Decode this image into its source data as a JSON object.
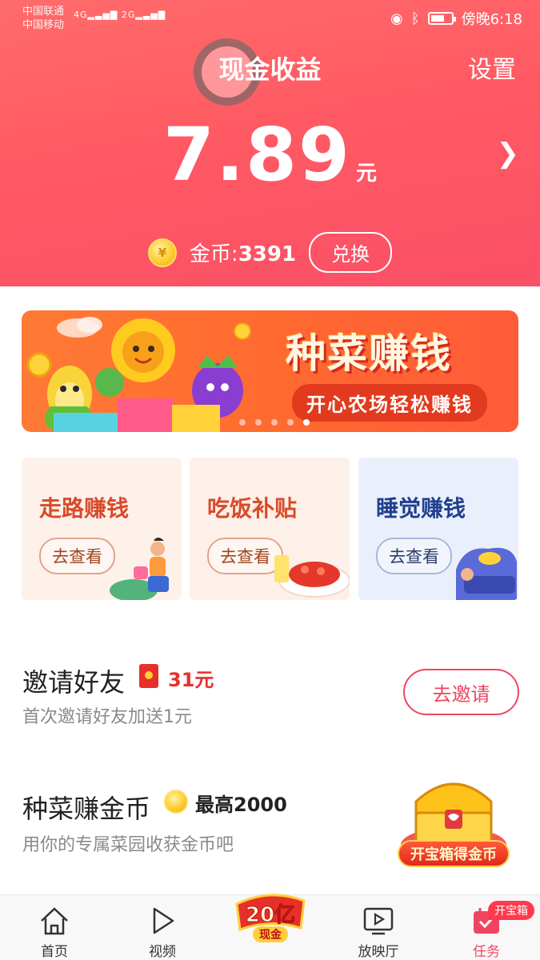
{
  "status_bar": {
    "carrier_1": "中国联通",
    "carrier_2": "中国移动",
    "signal_1": "4G",
    "signal_2": "2G",
    "time": "傍晚6:18"
  },
  "header": {
    "title": "现金收益",
    "settings_label": "设置",
    "amount": "7.89",
    "unit": "元",
    "coin_label": "金币:",
    "coin_count": "3391",
    "exchange_label": "兑换"
  },
  "banner": {
    "title": "种菜赚钱",
    "subtitle": "开心农场轻松赚钱",
    "page_count": 5,
    "active_page": 5
  },
  "cards": [
    {
      "title": "走路赚钱",
      "button": "去查看",
      "title_color": "#d94a2a",
      "bg": "#fdf1ea"
    },
    {
      "title": "吃饭补贴",
      "button": "去查看",
      "title_color": "#d94a2a",
      "bg": "#fdf0e8"
    },
    {
      "title": "睡觉赚钱",
      "button": "去查看",
      "title_color": "#1f3f8f",
      "bg": "#eaf0fb"
    }
  ],
  "invite": {
    "title": "邀请好友",
    "reward": "31元",
    "subtitle": "首次邀请好友加送1元",
    "button": "去邀请"
  },
  "farm": {
    "title": "种菜赚金币",
    "reward": "最高2000",
    "subtitle": "用你的专属菜园收获金币吧",
    "chest_label": "开宝箱得金币"
  },
  "bottom_nav": {
    "items": [
      {
        "label": "首页",
        "icon": "home-icon"
      },
      {
        "label": "视频",
        "icon": "play-icon"
      },
      {
        "label": "放映厅",
        "icon": "tv-icon"
      },
      {
        "label": "任务",
        "icon": "task-icon"
      }
    ],
    "promo_main": "20亿",
    "promo_sub": "现金",
    "badge": "开宝箱"
  },
  "colors": {
    "accent": "#f04561",
    "header_top": "#ff6b6b",
    "header_bottom": "#fb4f66"
  }
}
